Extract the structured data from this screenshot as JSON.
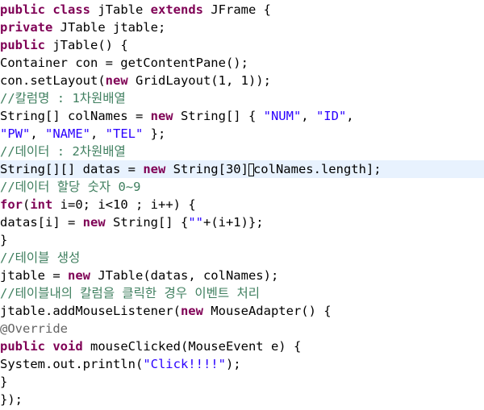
{
  "code": {
    "l1": {
      "a": "public",
      "b": " ",
      "c": "class",
      "d": " jTable ",
      "e": "extends",
      "f": " JFrame {"
    },
    "l2": {
      "a": "private",
      "b": " JTable jtable;"
    },
    "l3": {
      "a": "public",
      "b": " jTable() {"
    },
    "l4": {
      "a": "Container con = getContentPane();"
    },
    "l5": {
      "a": "con.setLayout(",
      "b": "new",
      "c": " GridLayout(1, 1));"
    },
    "l6": {
      "a": "//칼럼명 : 1차원배열"
    },
    "l7": {
      "a": "String[] colNames = ",
      "b": "new",
      "c": " String[] { ",
      "d": "\"NUM\"",
      "e": ", ",
      "f": "\"ID\"",
      "g": ","
    },
    "l8": {
      "a": "\"PW\"",
      "b": ", ",
      "c": "\"NAME\"",
      "d": ", ",
      "e": "\"TEL\"",
      "f": " };"
    },
    "l9": {
      "a": "//데이터 : 2차원배열"
    },
    "l10": {
      "a": "String[][] datas = ",
      "b": "new",
      "c": " String[30]",
      "d": "colNames.length];"
    },
    "l11": {
      "a": "//데이터 할당 숫자 0~9"
    },
    "l12": {
      "a": "for",
      "b": "(",
      "c": "int",
      "d": " i=0; i<10 ; i++) {"
    },
    "l13": {
      "a": "datas[i] = ",
      "b": "new",
      "c": " String[] {",
      "d": "\"\"",
      "e": "+(i+1)};"
    },
    "l14": {
      "a": "}"
    },
    "l15": {
      "a": "//테이블 생성"
    },
    "l16": {
      "a": "jtable = ",
      "b": "new",
      "c": " JTable(datas, colNames);"
    },
    "l17": {
      "a": "//테이블내의 칼럼을 클릭한 경우 이벤트 처리"
    },
    "l18": {
      "a": "jtable.addMouseListener(",
      "b": "new",
      "c": " MouseAdapter() {"
    },
    "l19": {
      "a": "@Override"
    },
    "l20": {
      "a": "public",
      "b": " ",
      "c": "void",
      "d": " mouseClicked(MouseEvent e) {"
    },
    "l21": {
      "a": "System.out.println(",
      "b": "\"Click!!!!\"",
      "c": ");"
    },
    "l22": {
      "a": "}"
    },
    "l23": {
      "a": "});"
    }
  },
  "colors": {
    "keyword": "#7f0055",
    "string": "#2a00ff",
    "comment": "#3f7f5f",
    "annotation": "#646464",
    "current_line": "#e8f2fe"
  }
}
